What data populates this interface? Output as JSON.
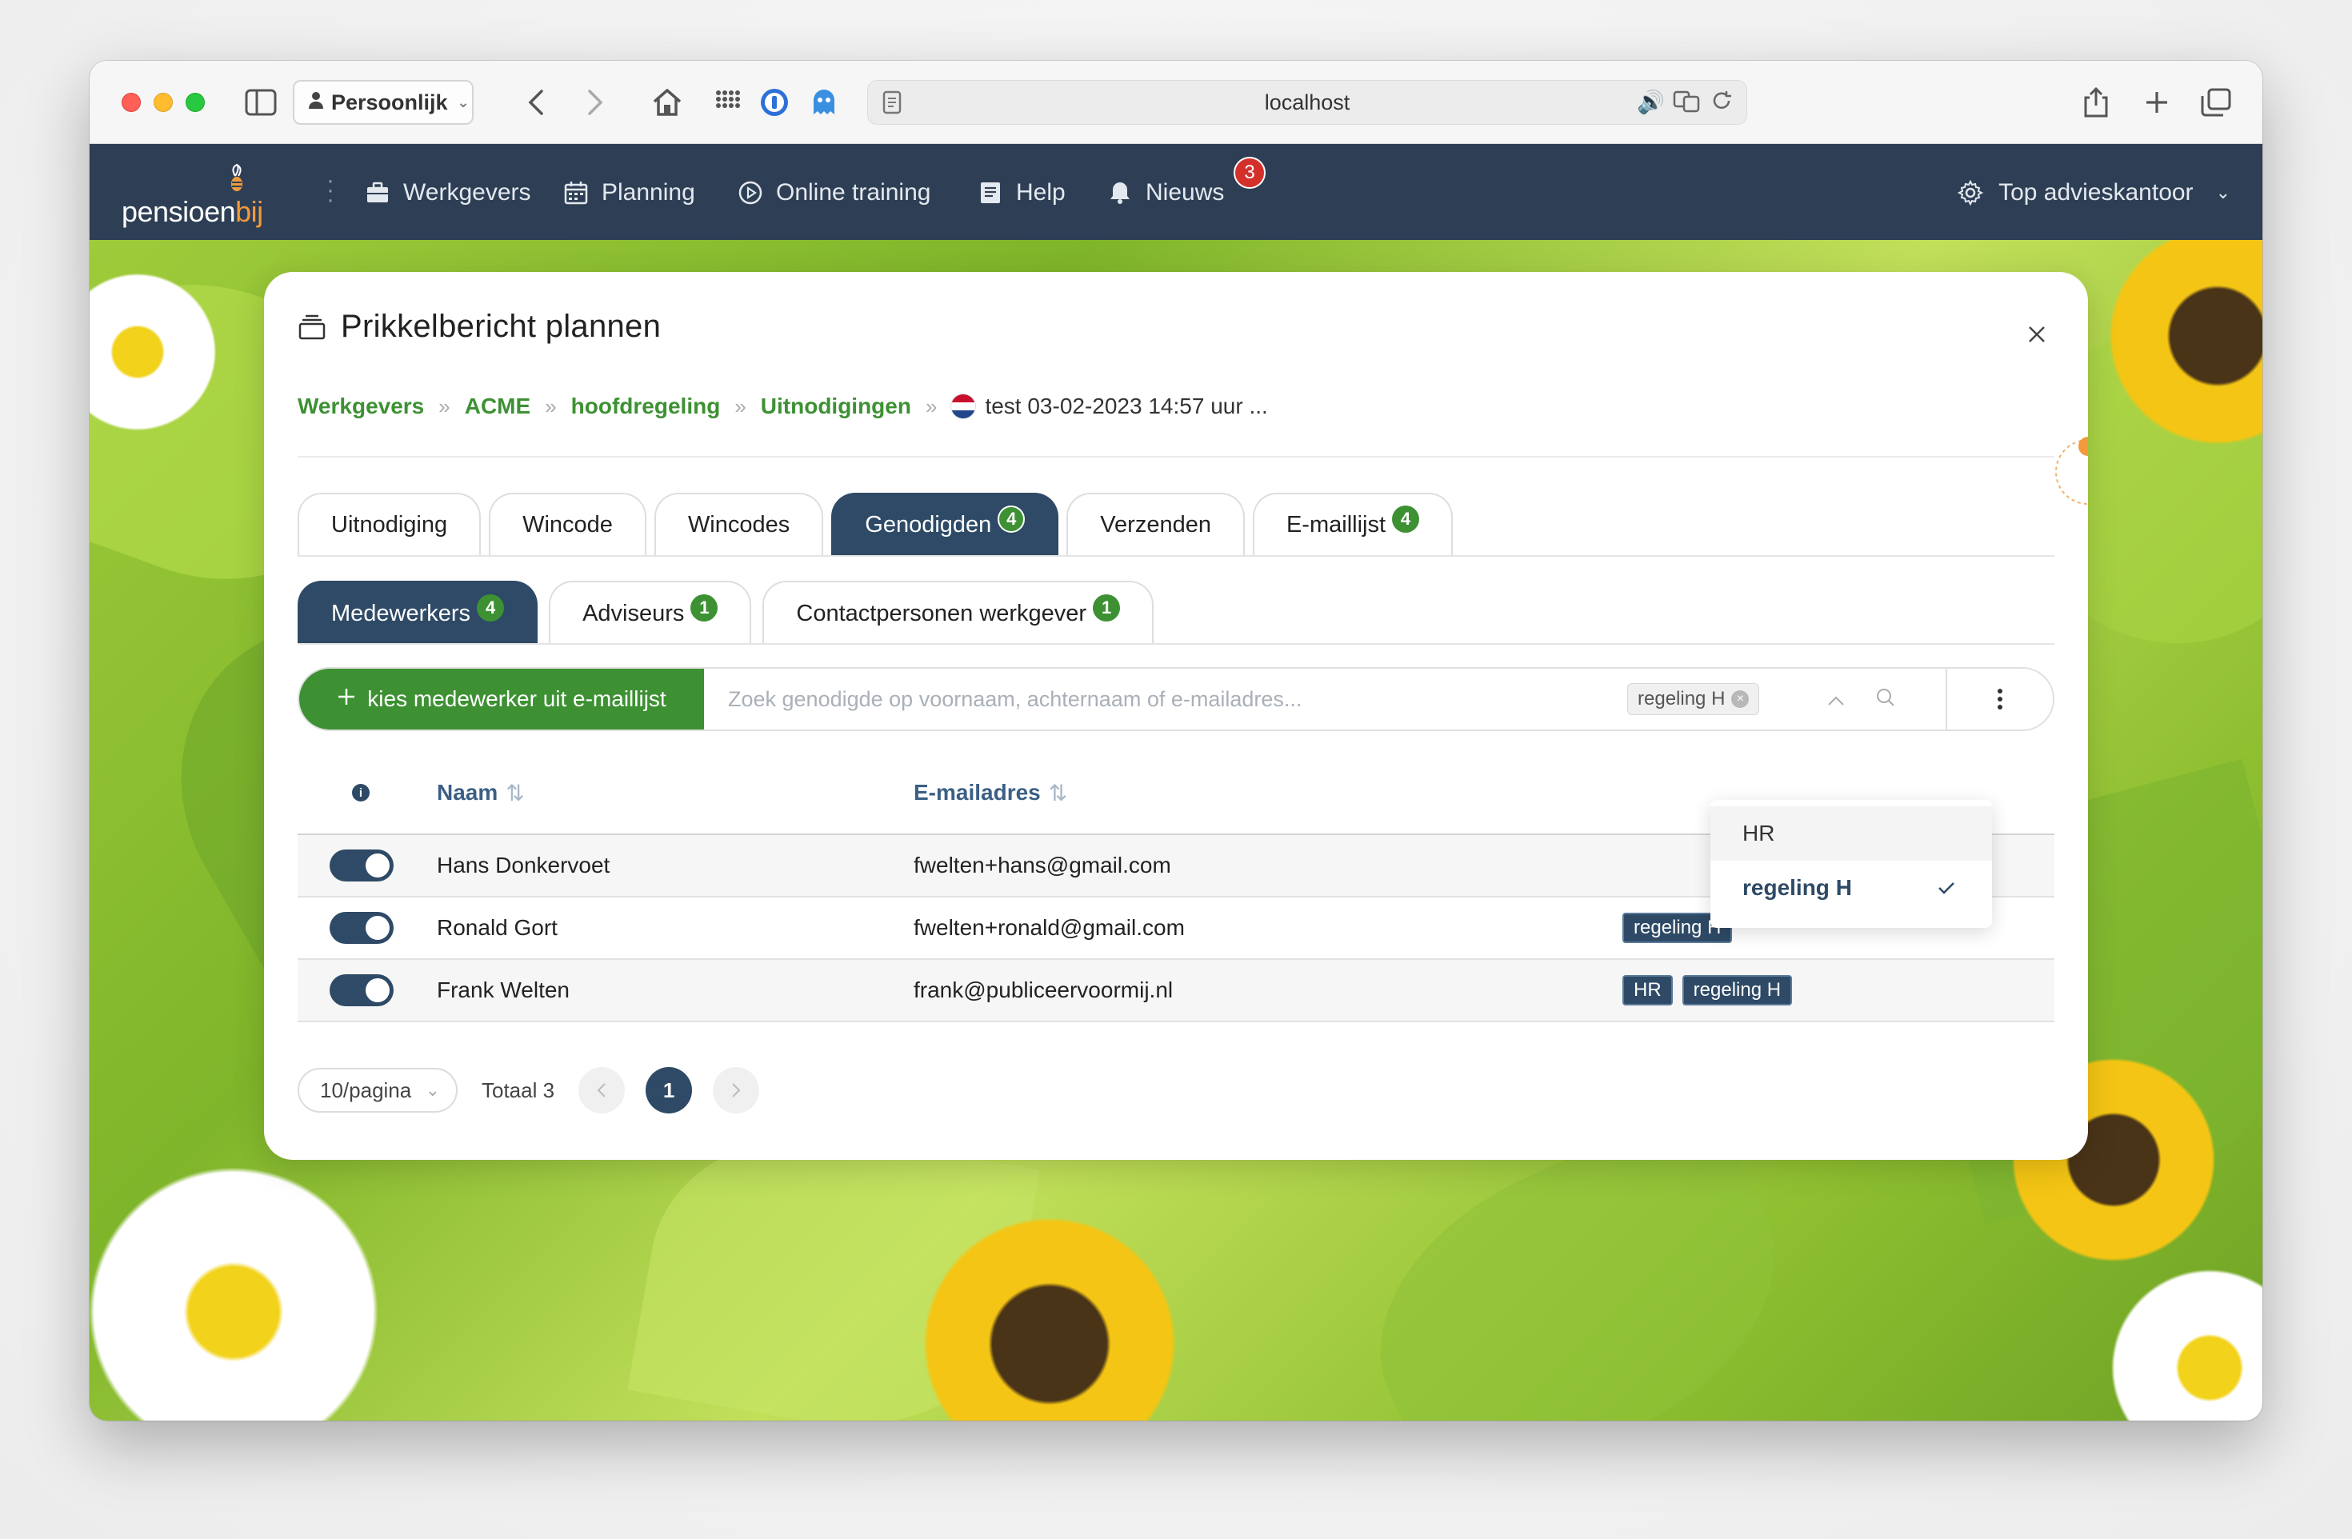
{
  "browser": {
    "profile": "Persoonlijk",
    "url": "localhost"
  },
  "nav": {
    "logo_main": "pensioen",
    "logo_accent": "bij",
    "items": [
      {
        "label": "Werkgevers",
        "icon": "briefcase-icon"
      },
      {
        "label": "Planning",
        "icon": "calendar-icon"
      },
      {
        "label": "Online training",
        "icon": "play-circle-icon"
      },
      {
        "label": "Help",
        "icon": "book-icon"
      },
      {
        "label": "Nieuws",
        "icon": "bell-icon"
      }
    ],
    "news_count": "3",
    "account": "Top advieskantoor"
  },
  "modal": {
    "title": "Prikkelbericht plannen",
    "breadcrumb": [
      "Werkgevers",
      "ACME",
      "hoofdregeling",
      "Uitnodigingen"
    ],
    "breadcrumb_current": "test 03-02-2023 14:57 uur ..."
  },
  "tabs": [
    {
      "label": "Uitnodiging",
      "badge": ""
    },
    {
      "label": "Wincode",
      "badge": ""
    },
    {
      "label": "Wincodes",
      "badge": ""
    },
    {
      "label": "Genodigden",
      "badge": "4"
    },
    {
      "label": "Verzenden",
      "badge": ""
    },
    {
      "label": "E-maillijst",
      "badge": "4"
    }
  ],
  "subtabs": [
    {
      "label": "Medewerkers",
      "badge": "4"
    },
    {
      "label": "Adviseurs",
      "badge": "1"
    },
    {
      "label": "Contactpersonen werkgever",
      "badge": "1"
    }
  ],
  "toolbar": {
    "add_label": "kies medewerker uit e-maillijst",
    "search_placeholder": "Zoek genodigde op voornaam, achternaam of e-mailadres...",
    "filter_chip": "regeling H"
  },
  "table": {
    "col_name": "Naam",
    "col_email": "E-mailadres",
    "rows": [
      {
        "name": "Hans Donkervoet",
        "email": "fwelten+hans@gmail.com",
        "tags": []
      },
      {
        "name": "Ronald Gort",
        "email": "fwelten+ronald@gmail.com",
        "tags": [
          "regeling H"
        ]
      },
      {
        "name": "Frank Welten",
        "email": "frank@publiceervoormij.nl",
        "tags": [
          "HR",
          "regeling H"
        ]
      }
    ]
  },
  "dropdown": {
    "options": [
      "HR",
      "regeling H"
    ],
    "selected": "regeling H"
  },
  "pagination": {
    "page_size": "10/pagina",
    "total": "Totaal 3",
    "current_page": "1"
  },
  "colors": {
    "navy": "#2e4a66",
    "green": "#3d9133",
    "navbar": "#2e3f55"
  }
}
